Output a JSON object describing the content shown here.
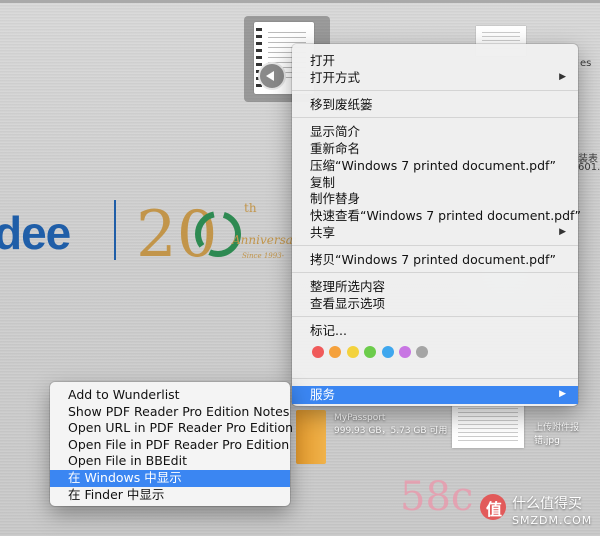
{
  "desktop": {
    "brand_text": "dee",
    "anniversary": {
      "number": "20",
      "suffix": "th",
      "word": "Anniversary",
      "since": "Since 1993-"
    },
    "right_snippet_es": "es",
    "right_snippet_a": "装表",
    "right_snippet_b": "601.",
    "drive": {
      "name": "MyPassport",
      "info": "999.93 GB，5.73 GB 可用"
    },
    "right_file_label": "上传附件报错.jpg"
  },
  "context_menu": {
    "items": [
      {
        "label": "打开"
      },
      {
        "label": "打开方式",
        "submenu": true
      },
      {
        "label": "移到废纸篓"
      },
      {
        "label": "显示简介"
      },
      {
        "label": "重新命名"
      },
      {
        "label": "压缩“Windows 7 printed document.pdf”"
      },
      {
        "label": "复制"
      },
      {
        "label": "制作替身"
      },
      {
        "label": "快速查看“Windows 7 printed document.pdf”"
      },
      {
        "label": "共享",
        "submenu": true
      },
      {
        "label": "拷贝“Windows 7 printed document.pdf”"
      },
      {
        "label": "整理所选内容"
      },
      {
        "label": "查看显示选项"
      },
      {
        "label": "标记..."
      },
      {
        "label": "服务",
        "submenu": true,
        "selected": true
      }
    ],
    "tag_colors": [
      "#f05a5a",
      "#f5a13c",
      "#f3d23d",
      "#6ccc4b",
      "#3fa7ee",
      "#c876e3",
      "#a5a5a5"
    ],
    "arrow_glyph": "▶"
  },
  "services_submenu": {
    "items": [
      {
        "label": "Add to Wunderlist"
      },
      {
        "label": "Show PDF Reader Pro Edition Notes"
      },
      {
        "label": "Open URL in PDF Reader Pro Edition"
      },
      {
        "label": "Open File in PDF Reader Pro Edition"
      },
      {
        "label": "Open File in BBEdit"
      },
      {
        "label": "在 Windows 中显示",
        "selected": true
      },
      {
        "label": "在 Finder 中显示"
      }
    ]
  },
  "watermarks": {
    "site58": "58c",
    "smzdm_icon": "值",
    "smzdm_cn": "什么值得买",
    "smzdm_en": "SMZDM.COM"
  },
  "colors": {
    "highlight": "#3b86f2",
    "brand_blue": "#1f5ea8",
    "anniv_gold": "#c2954a"
  }
}
